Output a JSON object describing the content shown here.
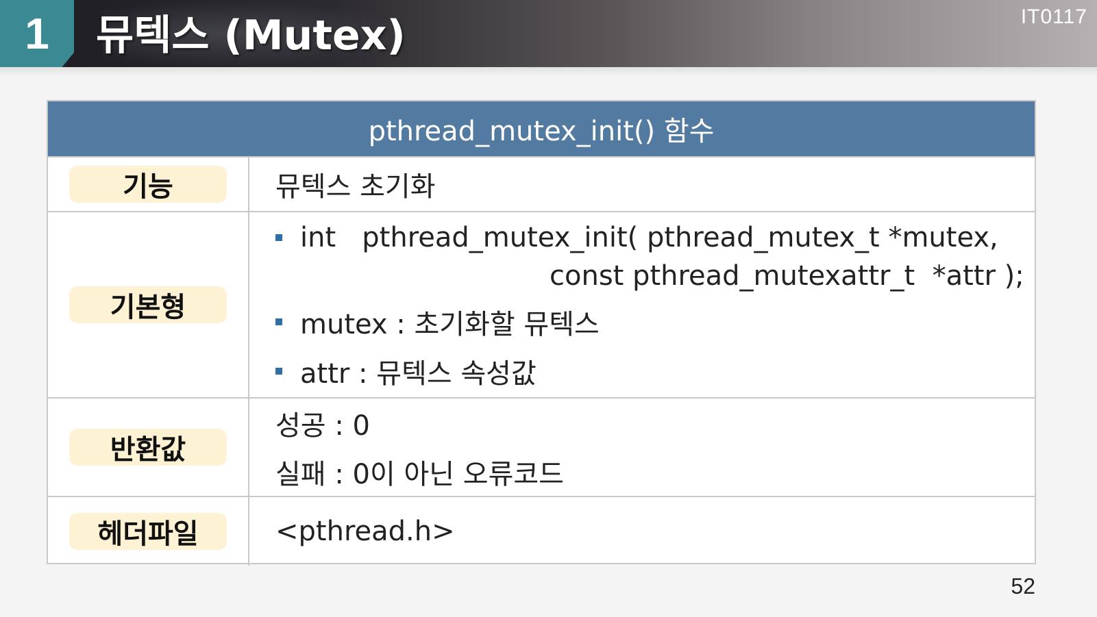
{
  "header": {
    "number": "1",
    "title": "뮤텍스 (Mutex)",
    "course_code": "IT0117"
  },
  "table": {
    "heading": "pthread_mutex_init() 함수",
    "rows": {
      "function": {
        "label": "기능",
        "value": "뮤텍스 초기화"
      },
      "prototype": {
        "label": "기본형",
        "line1": "int   pthread_mutex_init( pthread_mutex_t *mutex,",
        "line2": "const pthread_mutexattr_t  *attr );",
        "param1": "mutex : 초기화할 뮤텍스",
        "param2": "attr : 뮤텍스 속성값"
      },
      "return": {
        "label": "반환값",
        "success": "성공 : 0",
        "failure": "실패 : 0이 아닌 오류코드"
      },
      "header_file": {
        "label": "헤더파일",
        "value": "<pthread.h>"
      }
    }
  },
  "page_number": "52"
}
